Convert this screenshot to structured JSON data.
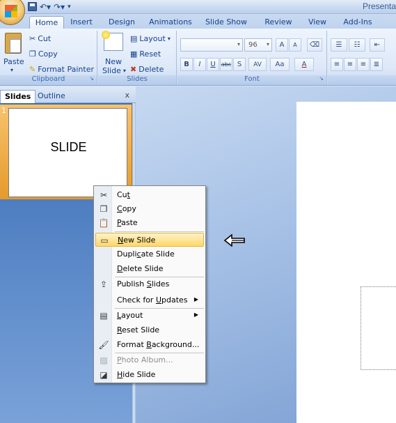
{
  "window": {
    "title": "Presenta"
  },
  "quick_access": {
    "save_icon": "save-icon",
    "undo_icon": "undo-icon",
    "redo_icon": "redo-icon"
  },
  "tabs": [
    {
      "label": "Home",
      "active": true
    },
    {
      "label": "Insert"
    },
    {
      "label": "Design"
    },
    {
      "label": "Animations"
    },
    {
      "label": "Slide Show"
    },
    {
      "label": "Review"
    },
    {
      "label": "View"
    },
    {
      "label": "Add-Ins"
    }
  ],
  "ribbon": {
    "clipboard": {
      "paste": "Paste",
      "cut": "Cut",
      "copy": "Copy",
      "format_painter": "Format Painter",
      "label": "Clipboard"
    },
    "slides": {
      "new_slide_1": "New",
      "new_slide_2": "Slide",
      "layout": "Layout",
      "reset": "Reset",
      "delete": "Delete",
      "label": "Slides"
    },
    "font": {
      "size": "96",
      "bold": "B",
      "italic": "I",
      "underline": "U",
      "strike": "abc",
      "shadow": "S",
      "spacing": "AV",
      "case": "Aa",
      "color": "A",
      "grow": "A",
      "shrink": "A",
      "label": "Font"
    }
  },
  "slides_pane": {
    "tab_slides": "Slides",
    "tab_outline": "Outline",
    "close": "x",
    "thumbnail_number": "1",
    "thumbnail_text": "SLIDE"
  },
  "context_menu": {
    "items": [
      {
        "pre": "Cu",
        "key": "t",
        "post": "",
        "icon": "scissors-icon"
      },
      {
        "pre": "",
        "key": "C",
        "post": "opy",
        "icon": "copy-icon"
      },
      {
        "pre": "",
        "key": "P",
        "post": "aste",
        "icon": "paste-icon"
      },
      {
        "pre": "",
        "key": "N",
        "post": "ew Slide",
        "icon": "new-slide-icon",
        "highlighted": true
      },
      {
        "pre": "Dupli",
        "key": "c",
        "post": "ate Slide"
      },
      {
        "pre": "",
        "key": "D",
        "post": "elete Slide"
      },
      {
        "pre": "Publish ",
        "key": "S",
        "post": "lides",
        "icon": "publish-slides-icon"
      },
      {
        "pre": "Check for ",
        "key": "U",
        "post": "pdates",
        "submenu": true
      },
      {
        "pre": "",
        "key": "L",
        "post": "ayout",
        "icon": "layout-icon",
        "submenu": true
      },
      {
        "pre": "",
        "key": "R",
        "post": "eset Slide"
      },
      {
        "pre": "Format ",
        "key": "B",
        "post": "ackground...",
        "icon": "format-background-icon"
      },
      {
        "pre": "",
        "key": "P",
        "post": "hoto Album...",
        "icon": "photo-album-icon",
        "disabled": true
      },
      {
        "pre": "",
        "key": "H",
        "post": "ide Slide",
        "icon": "hide-slide-icon"
      }
    ]
  },
  "annotation": {
    "icon": "left-arrow-icon"
  }
}
